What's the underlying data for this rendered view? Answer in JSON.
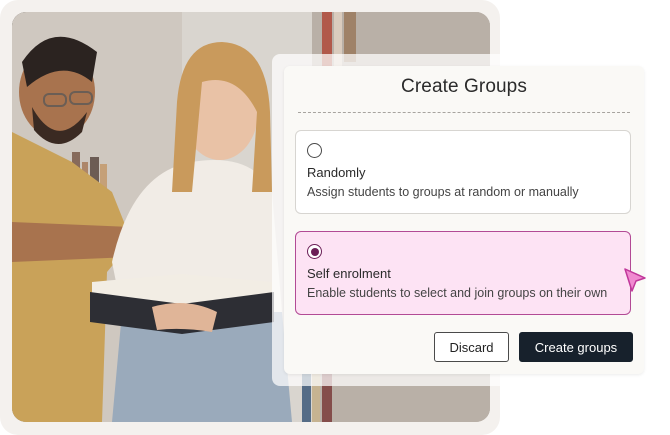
{
  "dialog": {
    "title": "Create Groups",
    "options": [
      {
        "label": "Randomly",
        "description": "Assign students to groups at random or manually",
        "selected": false
      },
      {
        "label": "Self enrolment",
        "description": "Enable students to select and join groups on their own",
        "selected": true
      }
    ],
    "discard_label": "Discard",
    "create_label": "Create groups"
  },
  "colors": {
    "selected_bg": "#fde3f4",
    "selected_border": "#b24a95",
    "primary_button": "#17212c",
    "cursor": "#f08ad0"
  },
  "icons": {
    "cursor": "pointer-arrow-icon"
  }
}
